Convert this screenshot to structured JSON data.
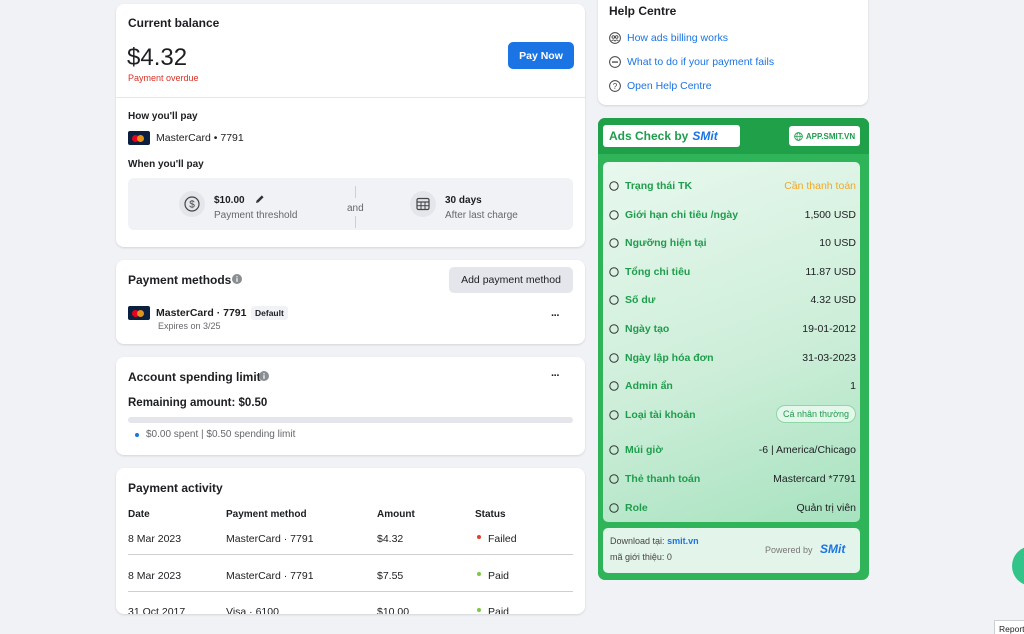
{
  "balance": {
    "title": "Current balance",
    "amount": "$4.32",
    "status": "Payment overdue",
    "pay_button": "Pay Now",
    "how_title": "How you'll pay",
    "card_label": "MasterCard • 7791",
    "when_title": "When you'll pay",
    "threshold_value": "$10.00",
    "threshold_label": "Payment threshold",
    "and_label": "and",
    "days_value": "30 days",
    "days_label": "After last charge"
  },
  "methods": {
    "title": "Payment methods",
    "add_button": "Add payment method",
    "card_label": "MasterCard · 7791",
    "default_badge": "Default",
    "expires": "Expires on 3/25",
    "more": "···"
  },
  "limit": {
    "title": "Account spending limit",
    "remaining": "Remaining amount: $0.50",
    "progress_fraction": 0.0,
    "legend": "$0.00 spent | $0.50 spending limit",
    "more": "···"
  },
  "activity": {
    "title": "Payment activity",
    "headers": [
      "Date",
      "Payment method",
      "Amount",
      "Status"
    ],
    "rows": [
      {
        "date": "8 Mar 2023",
        "method": "MasterCard · 7791",
        "amount": "$4.32",
        "status": "Failed",
        "status_color": "#e0402a"
      },
      {
        "date": "8 Mar 2023",
        "method": "MasterCard · 7791",
        "amount": "$7.55",
        "status": "Paid",
        "status_color": "#7ac943"
      },
      {
        "date": "31 Oct 2017",
        "method": "Visa · 6100",
        "amount": "$10.00",
        "status": "Paid",
        "status_color": "#7ac943"
      }
    ]
  },
  "help": {
    "title": "Help Centre",
    "links": [
      {
        "label": "How ads billing works",
        "icon": "people-icon"
      },
      {
        "label": "What to do if your payment fails",
        "icon": "minus-circle-icon"
      },
      {
        "label": "Open Help Centre",
        "icon": "question-circle-icon"
      }
    ]
  },
  "smit": {
    "title_prefix": "Ads Check by",
    "brand": "SMit",
    "site_button": "APP.SMIT.VN",
    "rows": [
      {
        "label": "Trạng thái TK",
        "value": "Cần thanh toán",
        "value_color": "#f5a623"
      },
      {
        "label": "Giới hạn chi tiêu /ngày",
        "value": "1,500 USD",
        "value_color": "#1c1e21"
      },
      {
        "label": "Ngưỡng hiện tại",
        "value": "10 USD",
        "value_color": "#1c1e21"
      },
      {
        "label": "Tổng chi tiêu",
        "value": "11.87 USD",
        "value_color": "#1c1e21"
      },
      {
        "label": "Số dư",
        "value": "4.32 USD",
        "value_color": "#1c1e21"
      },
      {
        "label": "Ngày tạo",
        "value": "19-01-2012",
        "value_color": "#1c1e21"
      },
      {
        "label": "Ngày lập hóa đơn",
        "value": "31-03-2023",
        "value_color": "#1c1e21"
      },
      {
        "label": "Admin ẩn",
        "value": "1",
        "value_color": "#1c1e21"
      },
      {
        "label": "Loại tài khoản",
        "value": "Cá nhân thường",
        "value_color": "#1f9d4d"
      },
      {
        "label": "Múi giờ",
        "value": "-6 | America/Chicago",
        "value_color": "#1c1e21"
      },
      {
        "label": "Thẻ thanh toán",
        "value": "Mastercard *7791",
        "value_color": "#1c1e21"
      },
      {
        "label": "Role",
        "value": "Quản trị viên",
        "value_color": "#1c1e21"
      }
    ],
    "download_prefix": "Download tại:",
    "download_link": "smit.vn",
    "referral": "mã giới thiệu: 0",
    "powered": "Powered by",
    "colors": {
      "green": "#1f9d4d",
      "orange": "#f5a623"
    }
  },
  "report_button": "Report"
}
